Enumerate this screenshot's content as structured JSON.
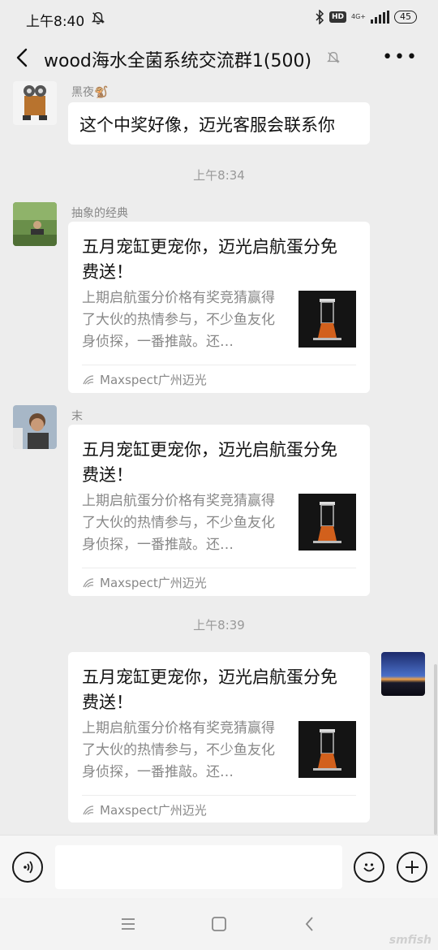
{
  "status": {
    "time": "上午8:40",
    "hd": "HD",
    "network": "4G+",
    "battery": "45"
  },
  "header": {
    "title": "wood海水全菌系统交流群1(500)",
    "more": "•••"
  },
  "messages": {
    "m1": {
      "sender": "黑夜🐒",
      "text": "这个中奖好像，迈光客服会联系你"
    },
    "t1": "上午8:34",
    "m2": {
      "sender": "抽象的经典",
      "title": "五月宠缸更宠你，迈光启航蛋分免费送！",
      "desc": "上期启航蛋分价格有奖竞猜赢得了大伙的热情参与，不少鱼友化身侦探，一番推敲。还…",
      "source": "Maxspect广州迈光"
    },
    "m3": {
      "sender": "末",
      "title": "五月宠缸更宠你，迈光启航蛋分免费送！",
      "desc": "上期启航蛋分价格有奖竞猜赢得了大伙的热情参与，不少鱼友化身侦探，一番推敲。还…",
      "source": "Maxspect广州迈光"
    },
    "t2": "上午8:39",
    "m4": {
      "title": "五月宠缸更宠你，迈光启航蛋分免费送！",
      "desc": "上期启航蛋分价格有奖竞猜赢得了大伙的热情参与，不少鱼友化身侦探，一番推敲。还…",
      "source": "Maxspect广州迈光"
    }
  },
  "watermark": "smfish"
}
